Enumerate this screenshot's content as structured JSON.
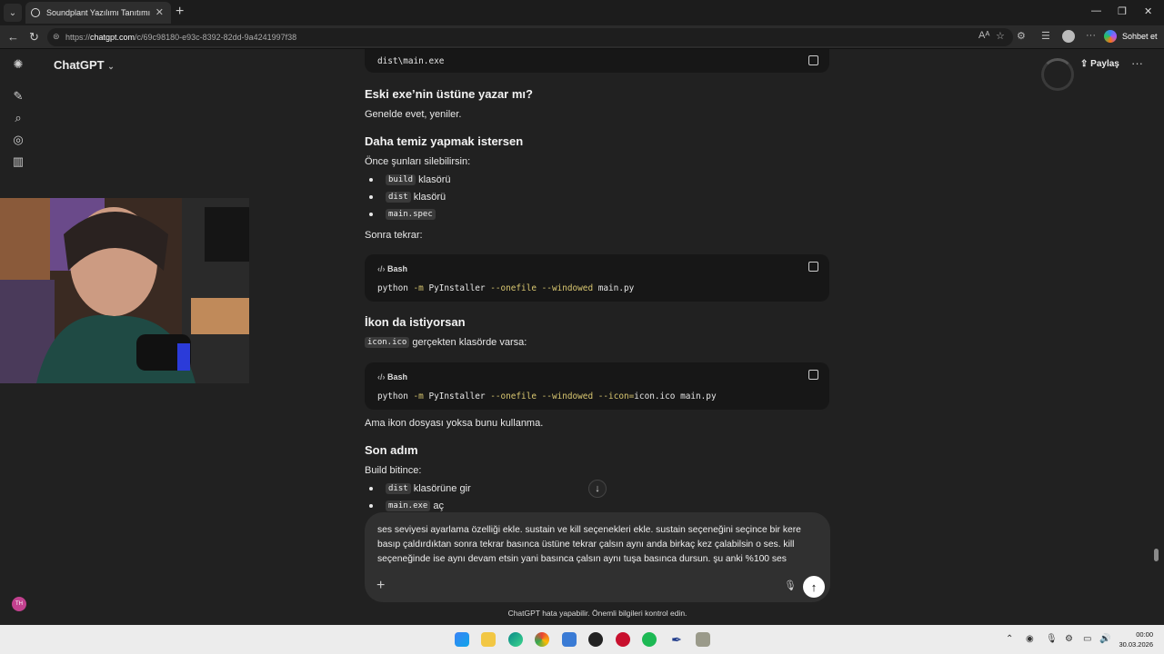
{
  "browser": {
    "tab_title": "Soundplant Yazılımı Tanıtımı",
    "url_scheme": "https://",
    "url_host": "chatgpt.com",
    "url_path": "/c/69c98180-e93c-8392-82dd-9a4241997f38",
    "chat_button": "Sohbet et"
  },
  "app": {
    "model_name": "ChatGPT",
    "share_label": "Paylaş",
    "user_initials": "TH"
  },
  "conversation": {
    "code1": "dist\\main.exe",
    "h1": "Eski exe’nin üstüne yazar mı?",
    "p1": "Genelde evet, yeniler.",
    "h2": "Daha temiz yapmak istersen",
    "p2": "Önce şunları silebilirsin:",
    "list1": [
      {
        "code": "build",
        "text": "klasörü"
      },
      {
        "code": "dist",
        "text": "klasörü"
      },
      {
        "code": "main.spec",
        "text": ""
      }
    ],
    "p3": "Sonra tekrar:",
    "codeblock1": {
      "lang": "Bash",
      "pre": "python ",
      "f1": "-m",
      "mid1": " PyInstaller ",
      "f2": "--onefile",
      "mid2": " ",
      "f3": "--windowed",
      "post": " main.py"
    },
    "h3": "İkon da istiyorsan",
    "p4_code": "icon.ico",
    "p4_text": "gerçekten klasörde varsa:",
    "codeblock2": {
      "lang": "Bash",
      "pre": "python ",
      "f1": "-m",
      "mid1": " PyInstaller ",
      "f2": "--onefile",
      "mid2": " ",
      "f3": "--windowed",
      "mid3": " ",
      "f4": "--icon=",
      "post": "icon.ico main.py"
    },
    "p5": "Ama ikon dosyası yoksa bunu kullanma.",
    "h4": "Son adım",
    "p6": "Build bitince:",
    "list2": [
      {
        "code": "dist",
        "text": "klasörüne gir"
      },
      {
        "code": "main.exe",
        "text": "aç"
      }
    ]
  },
  "composer": {
    "text": "ses seviyesi ayarlama özelliği ekle. sustain ve kill seçenekleri ekle. sustain seçeneğini seçince bir kere basıp çaldırdıktan sonra tekrar basınca üstüne tekrar çalsın aynı anda birkaç kez çalabilsin o ses. kill seçeneğinde ise aynı devam etsin yani basınca çalsın aynı tuşa basınca dursun. şu anki %100 ses"
  },
  "disclaimer": "ChatGPT hata yapabilir. Önemli bilgileri kontrol edin.",
  "taskbar": {
    "time": "00:00",
    "date": "30.03.2026"
  },
  "colors": {
    "background": "#212121",
    "code_bg": "#171717",
    "composer_bg": "#303030",
    "flag": "#d9c770"
  }
}
